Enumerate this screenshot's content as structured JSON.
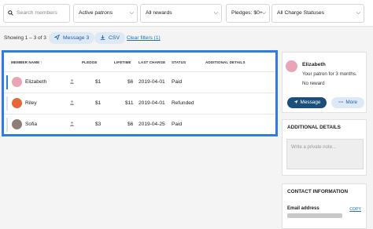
{
  "filters": {
    "search_placeholder": "Search members",
    "patron_status": "Active patrons",
    "rewards": "All rewards",
    "pledges": "Pledges: $0+",
    "charge_status": "All Charge Statuses"
  },
  "toolbar": {
    "showing": "Showing 1 – 3 of 3",
    "message_label": "Message 3",
    "csv_label": "CSV",
    "clear_filters": "Clear filters (1)"
  },
  "table": {
    "headers": {
      "member_name": "MEMBER NAME",
      "pledge": "PLEDGE",
      "lifetime": "LIFETIME",
      "last_charge": "LAST CHARGE",
      "status": "STATUS",
      "additional_details": "ADDITIONAL DETAILS"
    },
    "rows": [
      {
        "name": "Elizabeth",
        "pledge": "$1",
        "lifetime": "$6",
        "last_charge": "2019-04-01",
        "status": "Paid",
        "avatar_color": "#e9a4b8"
      },
      {
        "name": "Riley",
        "pledge": "$1",
        "lifetime": "$11",
        "last_charge": "2019-04-01",
        "status": "Refunded",
        "avatar_color": "#e8663a"
      },
      {
        "name": "Sofia",
        "pledge": "$3",
        "lifetime": "$6",
        "last_charge": "2019-04-25",
        "status": "Paid",
        "avatar_color": "#8c7f75"
      }
    ]
  },
  "profile": {
    "name": "Elizabeth",
    "line1": "Your patron for 3 months.",
    "line2": "No reward",
    "message_button": "Message",
    "more_button": "More"
  },
  "additional_details": {
    "title": "ADDITIONAL DETAILS",
    "placeholder": "Write a private note..."
  },
  "contact": {
    "title": "CONTACT INFORMATION",
    "email_label": "Email address",
    "copy_label": "COPY"
  },
  "colors": {
    "accent": "#2f7de1",
    "primary_button": "#1b4e7a",
    "pill_bg": "#dde9f5",
    "link": "#1d6fc0"
  }
}
